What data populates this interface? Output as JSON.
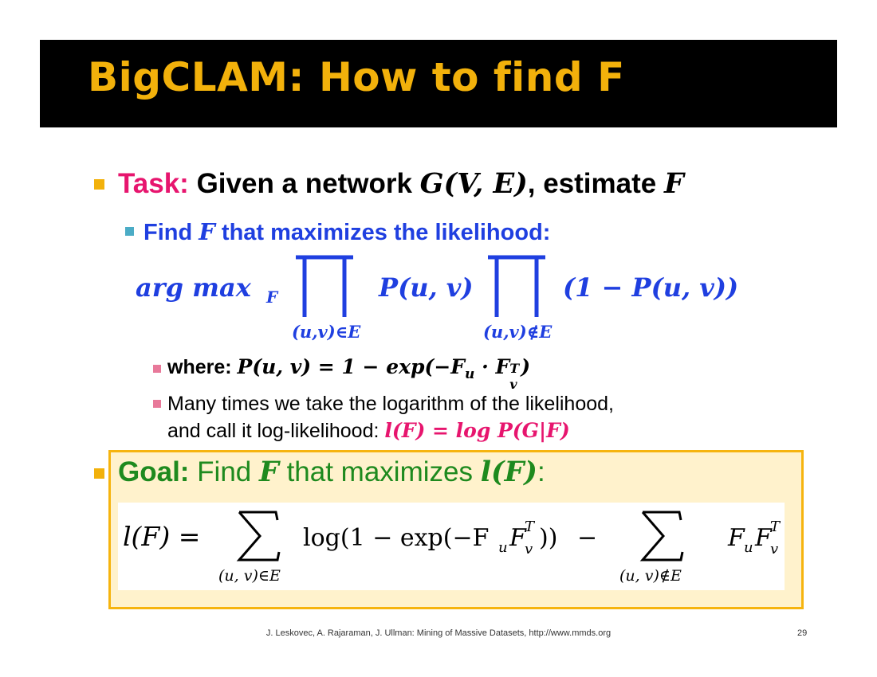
{
  "title": "BigCLAM: How to find F",
  "task": {
    "label": "Task:",
    "text_before": " Given a network ",
    "math_g": "G(V, E)",
    "text_after": ", estimate ",
    "math_f": "F"
  },
  "find": {
    "text_before": "Find ",
    "math_f": "F",
    "text_after": " that maximizes the likelihood:"
  },
  "argmax": {
    "arg_max": "arg max",
    "sub_f": "F",
    "puv": "P(u, v)",
    "one_minus": "(1 − P(u, v))",
    "sub_in": "(u,v)∈E",
    "sub_notin": "(u,v)∉E"
  },
  "where": {
    "label": "where: ",
    "lhs": "P(u, v) = 1 − exp(−F",
    "sub_u": "u",
    "dot": " · F",
    "sup_t": "T",
    "sub_v": "v",
    "close": ")"
  },
  "many": {
    "line1": "Many times we take the logarithm of the likelihood,",
    "line2_text": "and call it log-likelihood: ",
    "line2_math": "l(F) = log P(G|F)"
  },
  "goal": {
    "label": "Goal:",
    "text_before": " Find ",
    "math_f": "F",
    "text_after": " that maximizes ",
    "math_l": "l(F)",
    "colon": ":"
  },
  "formula": {
    "lhs": "l(F) =",
    "log_term": "log(1 − exp(−F",
    "sub_u": "u",
    "f2": "F",
    "sup_t": "T",
    "sub_v": "v",
    "close": "))",
    "minus": "−",
    "fu": "F",
    "sub_u2": "u",
    "fv": "F",
    "sup_t2": "T",
    "sub_v2": "v",
    "sum_in": "(u, v)∈E",
    "sum_notin": "(u, v)∉E"
  },
  "footer": "J. Leskovec, A. Rajaraman, J. Ullman: Mining of Massive Datasets, http://www.mmds.org",
  "page_number": "29",
  "colors": {
    "title": "#f2b10b",
    "accent_pink": "#e7156e",
    "accent_blue": "#1f3fe0",
    "accent_green": "#1e8a1e",
    "goal_bg": "#fff2cc",
    "goal_border": "#f6b40e"
  }
}
